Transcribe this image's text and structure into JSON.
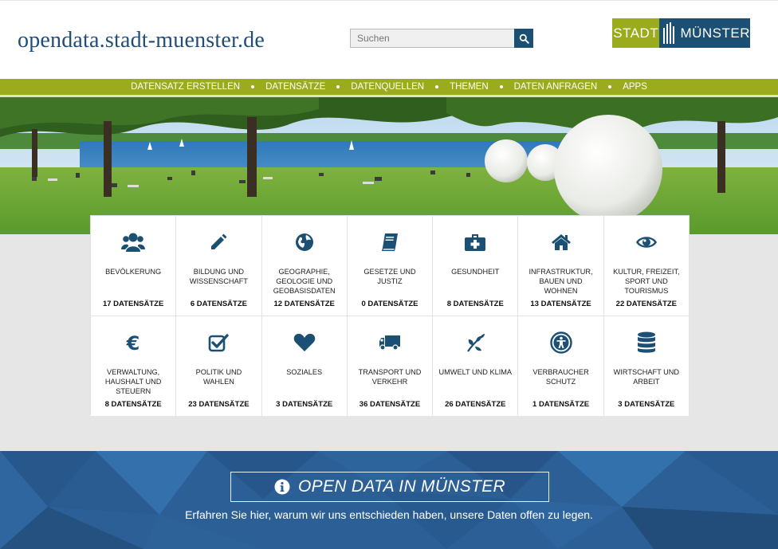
{
  "site": {
    "title": "opendata.stadt-muenster.de",
    "logo_left": "STADT",
    "logo_right": "MÜNSTER"
  },
  "search": {
    "placeholder": "Suchen"
  },
  "nav": {
    "items": [
      {
        "label": "DATENSATZ ERSTELLEN"
      },
      {
        "label": "DATENSÄTZE"
      },
      {
        "label": "DATENQUELLEN"
      },
      {
        "label": "THEMEN"
      },
      {
        "label": "DATEN ANFRAGEN"
      },
      {
        "label": "APPS"
      }
    ]
  },
  "categories": [
    {
      "name": "BEVÖLKERUNG",
      "count": "17 DATENSÄTZE",
      "icon": "users-icon"
    },
    {
      "name": "BILDUNG UND WISSENSCHAFT",
      "count": "6 DATENSÄTZE",
      "icon": "pencil-icon"
    },
    {
      "name": "GEOGRAPHIE, GEOLOGIE UND GEOBASISDATEN",
      "count": "12 DATENSÄTZE",
      "icon": "globe-icon"
    },
    {
      "name": "GESETZE UND JUSTIZ",
      "count": "0 DATENSÄTZE",
      "icon": "book-icon"
    },
    {
      "name": "GESUNDHEIT",
      "count": "8 DATENSÄTZE",
      "icon": "medkit-icon"
    },
    {
      "name": "INFRASTRUKTUR, BAUEN UND WOHNEN",
      "count": "13 DATENSÄTZE",
      "icon": "home-icon"
    },
    {
      "name": "KULTUR, FREIZEIT, SPORT UND TOURISMUS",
      "count": "22 DATENSÄTZE",
      "icon": "eye-icon"
    },
    {
      "name": "VERWALTUNG, HAUSHALT UND STEUERN",
      "count": "8 DATENSÄTZE",
      "icon": "euro-icon"
    },
    {
      "name": "POLITIK UND WAHLEN",
      "count": "23 DATENSÄTZE",
      "icon": "checkbox-icon"
    },
    {
      "name": "SOZIALES",
      "count": "3 DATENSÄTZE",
      "icon": "heart-icon"
    },
    {
      "name": "TRANSPORT UND VERKEHR",
      "count": "36 DATENSÄTZE",
      "icon": "truck-icon"
    },
    {
      "name": "UMWELT UND KLIMA",
      "count": "26 DATENSÄTZE",
      "icon": "leaf-icon"
    },
    {
      "name": "VERBRAUCHER SCHUTZ",
      "count": "1 DATENSÄTZE",
      "icon": "accessibility-icon"
    },
    {
      "name": "WIRTSCHAFT UND ARBEIT",
      "count": "3 DATENSÄTZE",
      "icon": "database-icon"
    }
  ],
  "band": {
    "button_label": "OPEN DATA IN MÜNSTER",
    "subtitle": "Erfahren Sie hier, warum wir uns entschieden haben, unsere Daten offen zu legen."
  },
  "colors": {
    "brand_blue": "#1b4f73",
    "brand_green": "#9aab1c",
    "band_blue": "#2b5f95"
  }
}
